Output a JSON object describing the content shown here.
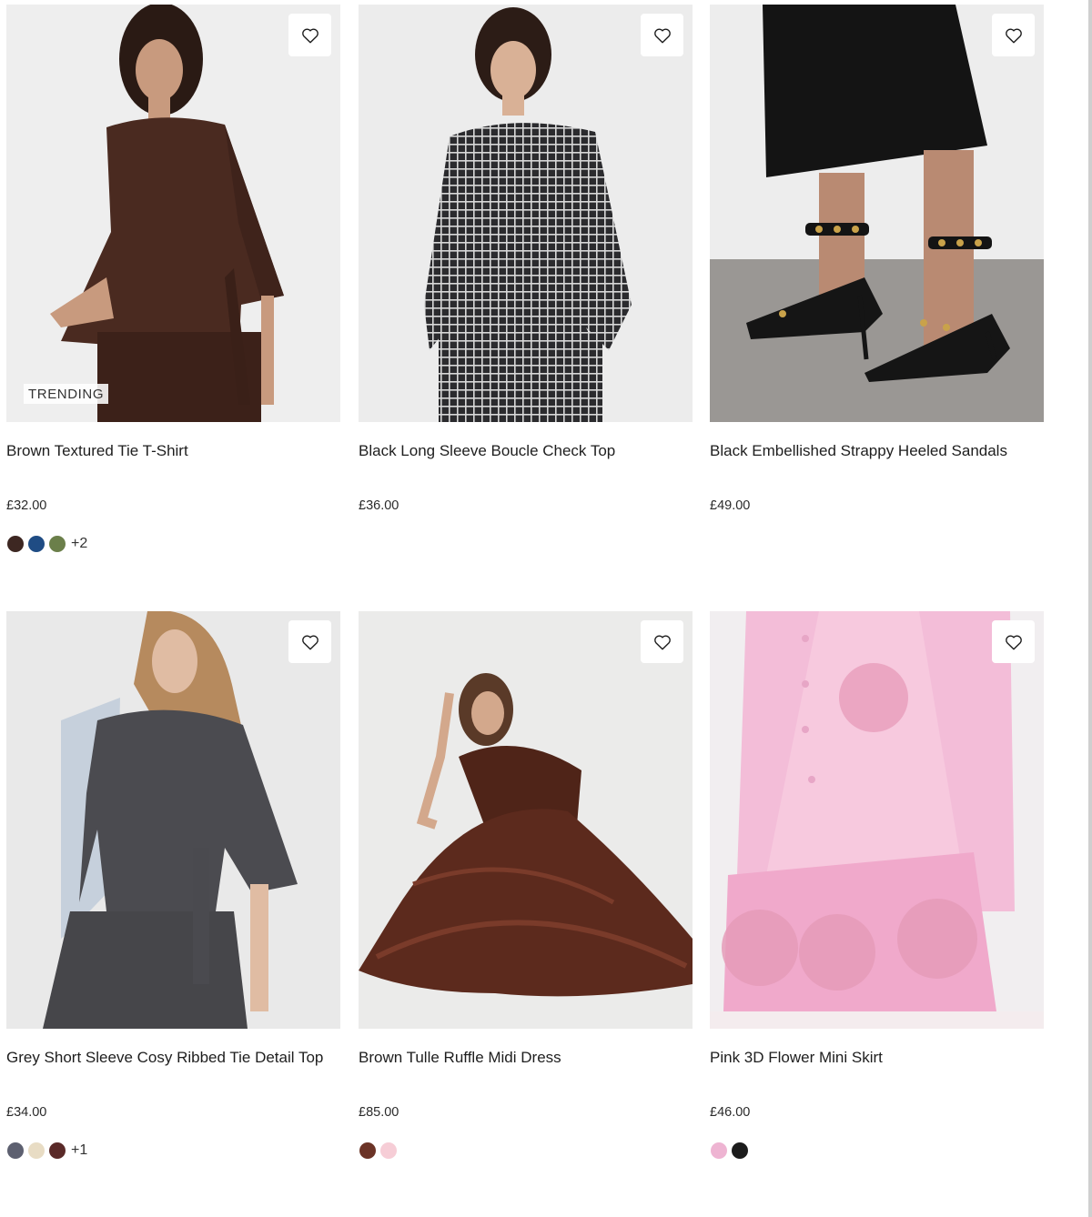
{
  "products": [
    {
      "name": "Brown Textured Tie T-Shirt",
      "price": "£32.00",
      "badge": "TRENDING",
      "swatches": [
        "#3d2722",
        "#1f4c84",
        "#6b7f4a"
      ],
      "more": "+2"
    },
    {
      "name": "Black Long Sleeve Boucle Check Top",
      "price": "£36.00",
      "swatches": []
    },
    {
      "name": "Black Embellished Strappy Heeled Sandals",
      "price": "£49.00",
      "swatches": []
    },
    {
      "name": "Grey Short Sleeve Cosy Ribbed Tie Detail Top",
      "price": "£34.00",
      "swatches": [
        "#5d6070",
        "#e8dcc4",
        "#5a2a28"
      ],
      "more": "+1"
    },
    {
      "name": "Brown Tulle Ruffle Midi Dress",
      "price": "£85.00",
      "swatches": [
        "#6b3326",
        "#f6cdd6"
      ]
    },
    {
      "name": "Pink 3D Flower Mini Skirt",
      "price": "£46.00",
      "swatches": [
        "#eeb4d2",
        "#1c1c1c"
      ]
    }
  ],
  "icons": {
    "wishlist": "heart-outline-icon"
  }
}
